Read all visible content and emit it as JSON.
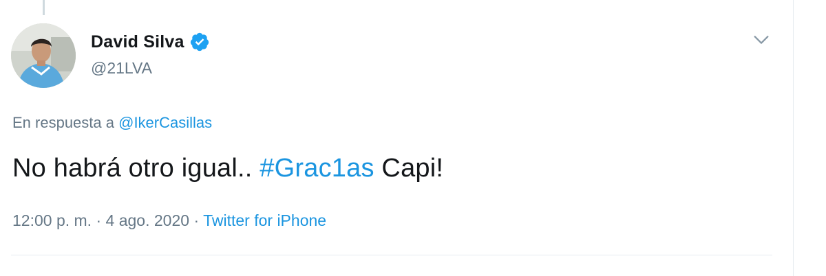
{
  "tweet": {
    "author": {
      "display_name": "David Silva",
      "handle": "@21LVA",
      "verified": true,
      "avatar_icon": "profile-photo"
    },
    "reply_prefix": "En respuesta a",
    "reply_mention": "@IkerCasillas",
    "text_before": "No habrá otro igual..",
    "hashtag": "#Grac1as",
    "text_after": "Capi!",
    "time": "12:00 p. m.",
    "date": "4 ago. 2020",
    "separator": "·",
    "source": "Twitter for iPhone",
    "menu_icon": "chevron-down-icon"
  },
  "colors": {
    "link": "#1b95e0",
    "secondary_text": "#657786",
    "primary_text": "#14171a",
    "verified_badge": "#1da1f2",
    "divider": "#e6ecf0"
  }
}
